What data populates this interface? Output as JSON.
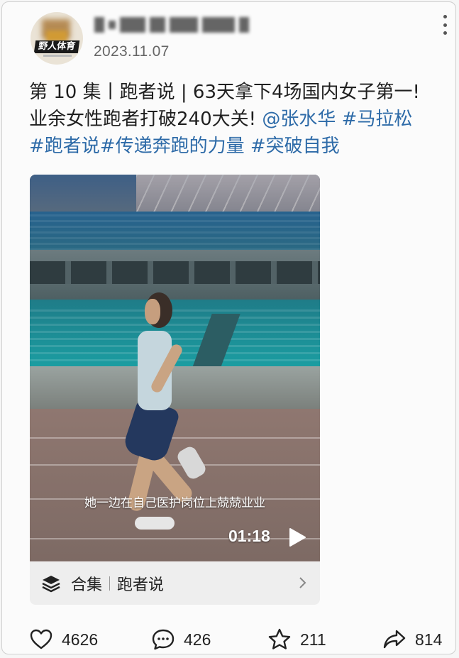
{
  "header": {
    "username": "",
    "avatar_logo_text": "野人体育",
    "date": "2023.11.07"
  },
  "post": {
    "line1": "第 10 集丨跑者说 | 63天拿下4场国内女子第一!",
    "line2_plain": "业余女性跑者打破240大关! ",
    "mention": "@张水华",
    "tag1": " #马拉松",
    "tag2": "#跑者说",
    "tag3": "#传递奔跑的力量",
    "tag4": " #突破自我"
  },
  "video": {
    "subtitle": "她一边在自己医护岗位上兢兢业业",
    "duration": "01:18",
    "play_icon": "play-icon"
  },
  "collection": {
    "label": "合集",
    "name": "跑者说",
    "icon": "layers-icon"
  },
  "actions": {
    "likes": "4626",
    "comments": "426",
    "favorites": "211",
    "shares": "814"
  },
  "colors": {
    "tag": "#2e6ba8",
    "text": "#1f1f1f",
    "meta": "#666666"
  }
}
